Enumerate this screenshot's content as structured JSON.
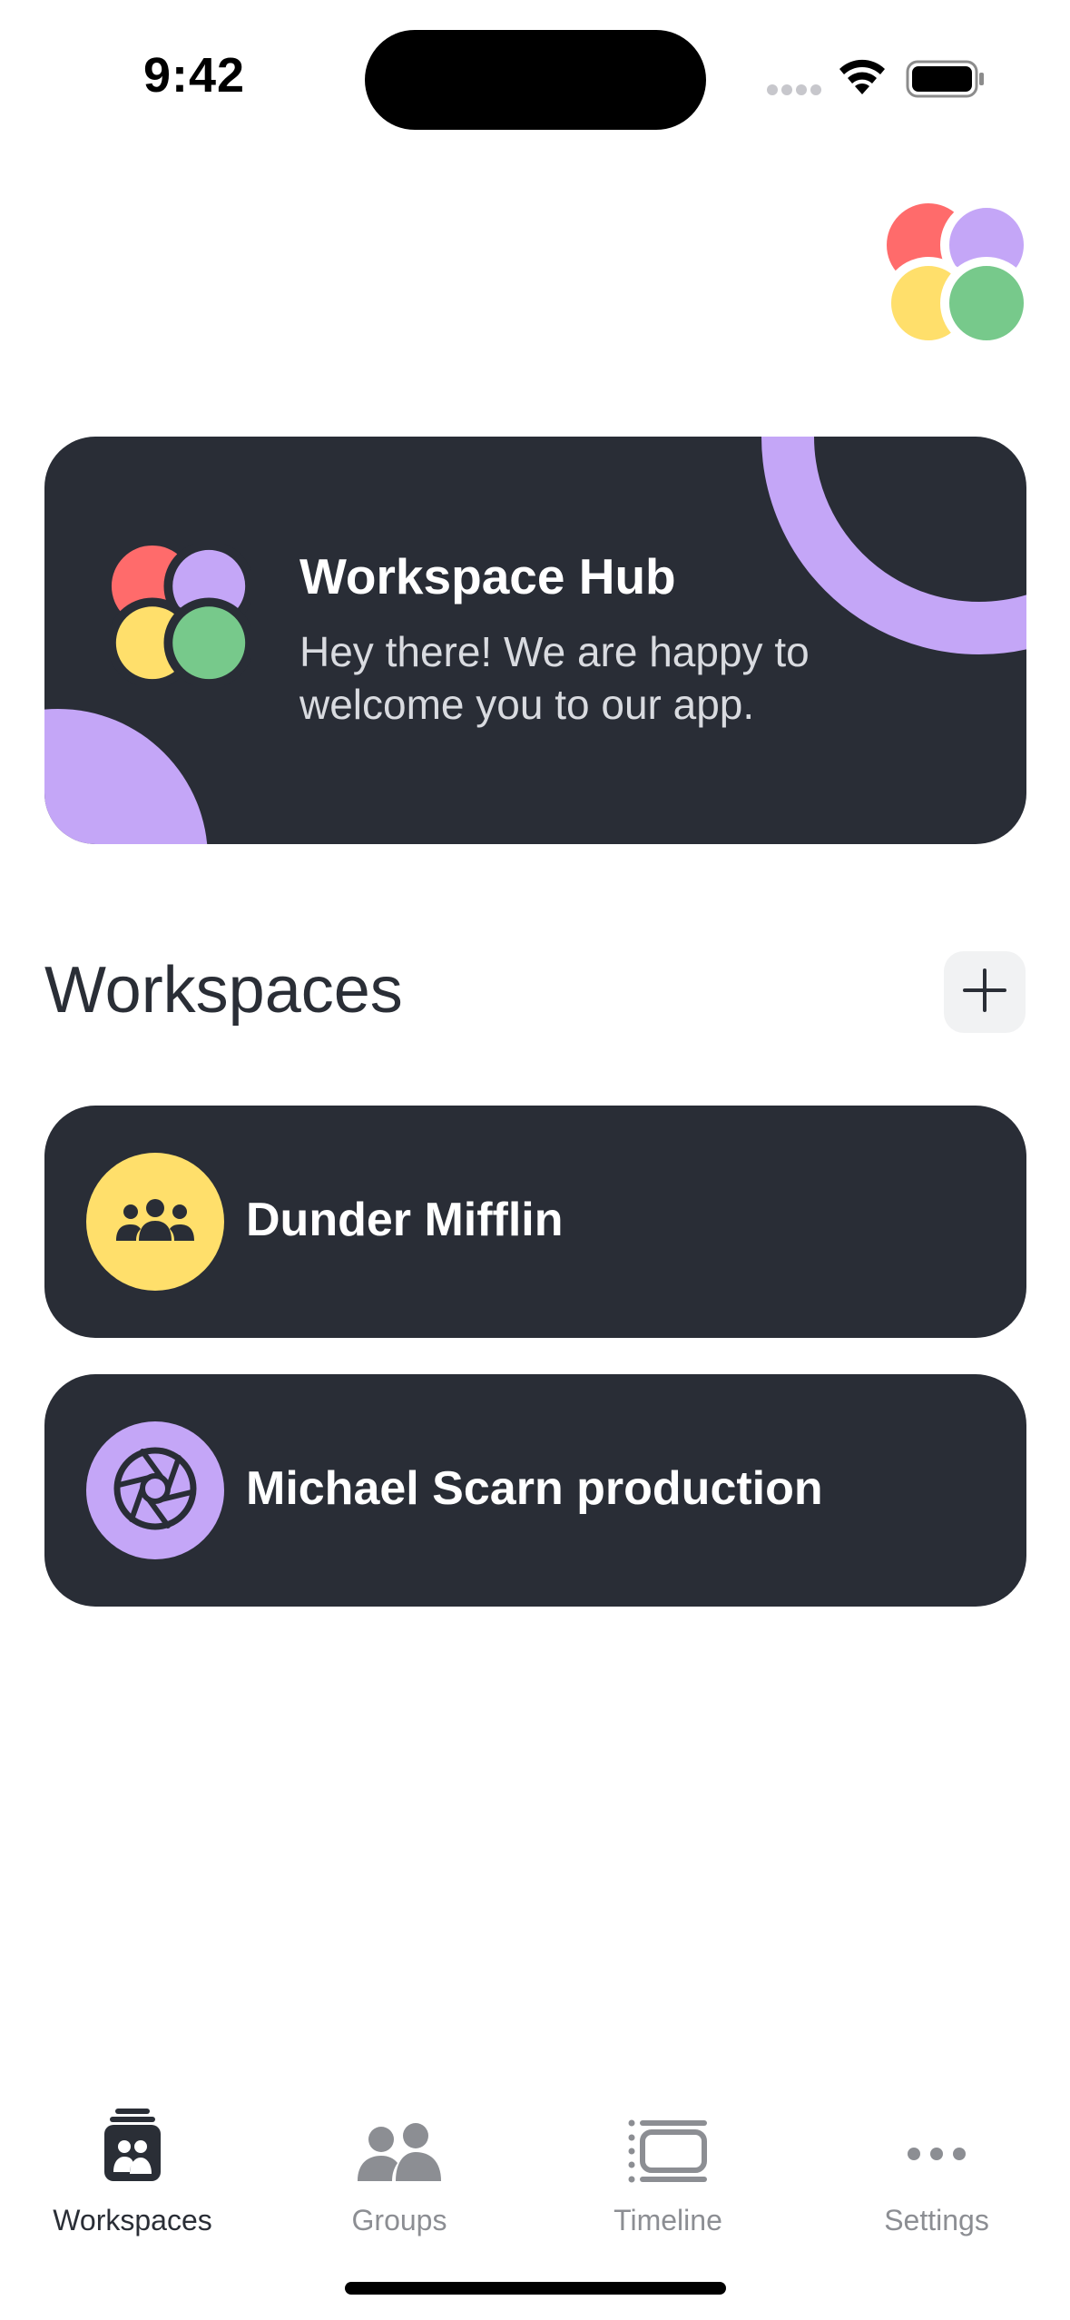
{
  "status_bar": {
    "time": "9:42"
  },
  "hero": {
    "title": "Workspace Hub",
    "subtitle": "Hey there! We are happy to welcome you to our app."
  },
  "section": {
    "title": "Workspaces",
    "add_icon": "plus-icon"
  },
  "workspaces": [
    {
      "name": "Dunder Mifflin",
      "icon": "people-group-icon",
      "color": "#ffdf6b"
    },
    {
      "name": "Michael Scarn production",
      "icon": "camera-aperture-icon",
      "color": "#c4a6f7"
    }
  ],
  "tab_bar": {
    "items": [
      {
        "label": "Workspaces",
        "icon": "workspaces-icon",
        "active": true
      },
      {
        "label": "Groups",
        "icon": "groups-icon",
        "active": false
      },
      {
        "label": "Timeline",
        "icon": "timeline-icon",
        "active": false
      },
      {
        "label": "Settings",
        "icon": "more-dots-icon",
        "active": false
      }
    ]
  },
  "colors": {
    "card_dark": "#292d36",
    "accent_purple": "#c4a6f7",
    "accent_yellow": "#ffdf6b",
    "accent_red": "#ff6b6b",
    "accent_green": "#77c98b"
  }
}
